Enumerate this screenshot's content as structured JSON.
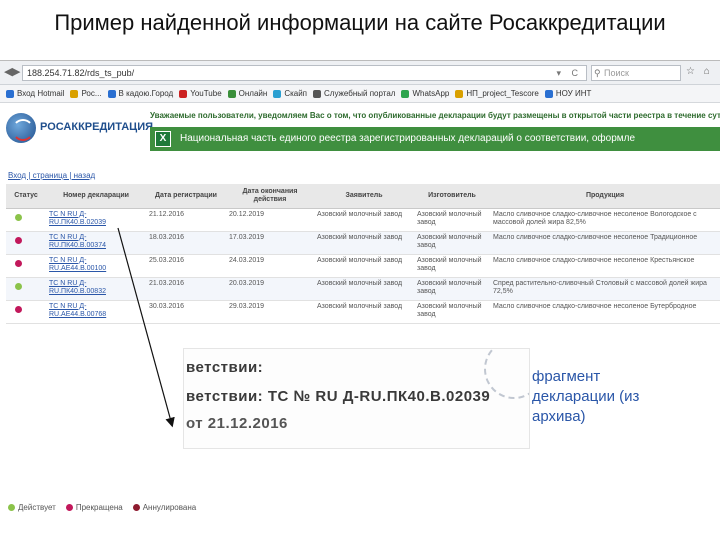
{
  "slide_title": "Пример найденной информации на сайте Росаккредитации",
  "browser": {
    "url": "188.254.71.82/rds_ts_pub/",
    "search_placeholder": "Поиск",
    "nav_back": "◀",
    "nav_forward": "▶",
    "url_icons": "▾ C"
  },
  "bookmarks": [
    {
      "label": "Вход Hotmail",
      "color": "#2a6fd1"
    },
    {
      "label": "Рос...",
      "color": "#d9a000"
    },
    {
      "label": "В кадою.Город",
      "color": "#2a6fd1"
    },
    {
      "label": "YouTube",
      "color": "#cc2222"
    },
    {
      "label": "Онлайн",
      "color": "#3a8f3a"
    },
    {
      "label": "Скайп",
      "color": "#2a9fd1"
    },
    {
      "label": "Служебный портал",
      "color": "#555555"
    },
    {
      "label": "WhatsApp",
      "color": "#2da44e"
    },
    {
      "label": "НП_project_Tescore",
      "color": "#d9a000"
    },
    {
      "label": "НОУ ИНТ",
      "color": "#2a6fd1"
    }
  ],
  "site": {
    "logo_text": "РОСАККРЕДИТАЦИЯ",
    "notice": "Уважаемые пользователи, уведомляем Вас о том, что опубликованные декларации будут размещены в открытой части реестра в течение суток с мо",
    "banner": "Национальная часть единого реестра зарегистрированных деклараций о соответствии, оформле",
    "excel_icon_letter": "X"
  },
  "back_link": "Вход | страница  | назад",
  "table": {
    "headers": [
      "Статус",
      "Номер декларации",
      "Дата регистрации",
      "Дата окончания действия",
      "Заявитель",
      "Изготовитель",
      "Продукция"
    ],
    "rows": [
      {
        "status_color": "#8bc34a",
        "number": "ТС N RU Д-RU.ПК40.В.02039",
        "reg_date": "21.12.2016",
        "end_date": "20.12.2019",
        "applicant": "Азовский молочный завод",
        "maker": "Азовский молочный завод",
        "product": "Масло сливочное сладко-сливочное несоленое Вологодское с массовой долей жира 82,5%"
      },
      {
        "status_color": "#c2185b",
        "number": "ТС N RU Д-RU.ПК40.В.00374",
        "reg_date": "18.03.2016",
        "end_date": "17.03.2019",
        "applicant": "Азовский молочный завод",
        "maker": "Азовский молочный завод",
        "product": "Масло сливочное сладко-сливочное несоленое Традиционное"
      },
      {
        "status_color": "#c2185b",
        "number": "ТС N RU Д-RU.АЕ44.В.00100",
        "reg_date": "25.03.2016",
        "end_date": "24.03.2019",
        "applicant": "Азовский молочный завод",
        "maker": "Азовский молочный завод",
        "product": "Масло сливочное сладко-сливочное несоленое Крестьянское"
      },
      {
        "status_color": "#8bc34a",
        "number": "ТС N RU Д-RU.ПК40.В.00832",
        "reg_date": "21.03.2016",
        "end_date": "20.03.2019",
        "applicant": "Азовский молочный завод",
        "maker": "Азовский молочный завод",
        "product": "Спред растительно-сливочный Столовый с массовой долей жира 72,5%"
      },
      {
        "status_color": "#c2185b",
        "number": "ТС N RU Д-RU.АЕ44.В.00768",
        "reg_date": "30.03.2016",
        "end_date": "29.03.2019",
        "applicant": "Азовский молочный завод",
        "maker": "Азовский молочный завод",
        "product": "Масло сливочное сладко-сливочное несоленое Бутербродное"
      }
    ]
  },
  "fragment": {
    "line1": "ветствии:",
    "line2": "ветствии: ТС № RU Д-RU.ПК40.В.02039",
    "line3": "от 21.12.2016"
  },
  "fragment_caption": "фрагмент декларации (из архива)",
  "legend": [
    {
      "label": "Действует",
      "color": "#8bc34a"
    },
    {
      "label": "Прекращена",
      "color": "#c2185b"
    },
    {
      "label": "Аннулирована",
      "color": "#8e1b2f"
    }
  ]
}
